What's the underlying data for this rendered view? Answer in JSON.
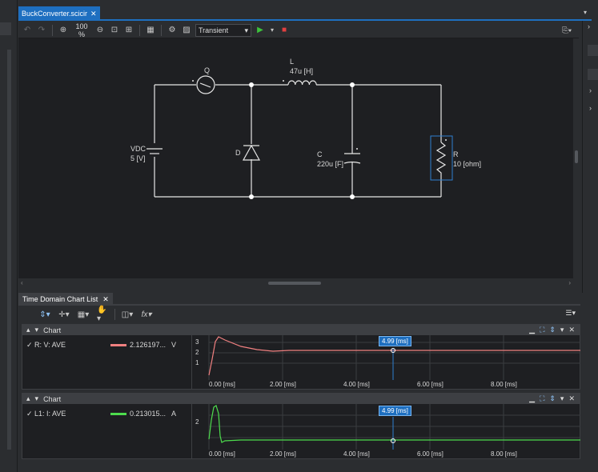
{
  "editor": {
    "tab_label": "BuckConverter.scicir",
    "zoom": "100 %",
    "analysis_mode": "Transient",
    "colors": {
      "accent": "#1e6fc0",
      "run": "#3cc23c",
      "stop": "#e24040",
      "wire": "#e6e6e6",
      "selection": "#2d7fd0"
    }
  },
  "circuit": {
    "source": {
      "name": "VDC",
      "value": "5 [V]"
    },
    "switch": {
      "name": "Q"
    },
    "diode": {
      "name": "D"
    },
    "inductor": {
      "name": "L",
      "value": "47u [H]"
    },
    "capacitor": {
      "name": "C",
      "value": "220u [F]"
    },
    "resistor": {
      "name": "R",
      "value": "10 [ohm]"
    }
  },
  "bottom_panel": {
    "tab_label": "Time Domain Chart List",
    "charts": [
      {
        "title": "Chart",
        "legend": {
          "name": "R: V: AVE",
          "value": "2.126197...",
          "unit": "V",
          "color": "#f08080"
        },
        "cursor_label": "4.99 [ms]",
        "y_ticks": [
          "3",
          "2",
          "1"
        ],
        "x_ticks": [
          "0.00 [ms]",
          "2.00 [ms]",
          "4.00 [ms]",
          "6.00 [ms]",
          "8.00 [ms]"
        ]
      },
      {
        "title": "Chart",
        "legend": {
          "name": "L1: I: AVE",
          "value": "0.213015...",
          "unit": "A",
          "color": "#4ddc4d"
        },
        "cursor_label": "4.99 [ms]",
        "y_ticks": [
          "2"
        ],
        "x_ticks": [
          "0.00 [ms]",
          "2.00 [ms]",
          "4.00 [ms]",
          "6.00 [ms]",
          "8.00 [ms]"
        ]
      }
    ]
  }
}
